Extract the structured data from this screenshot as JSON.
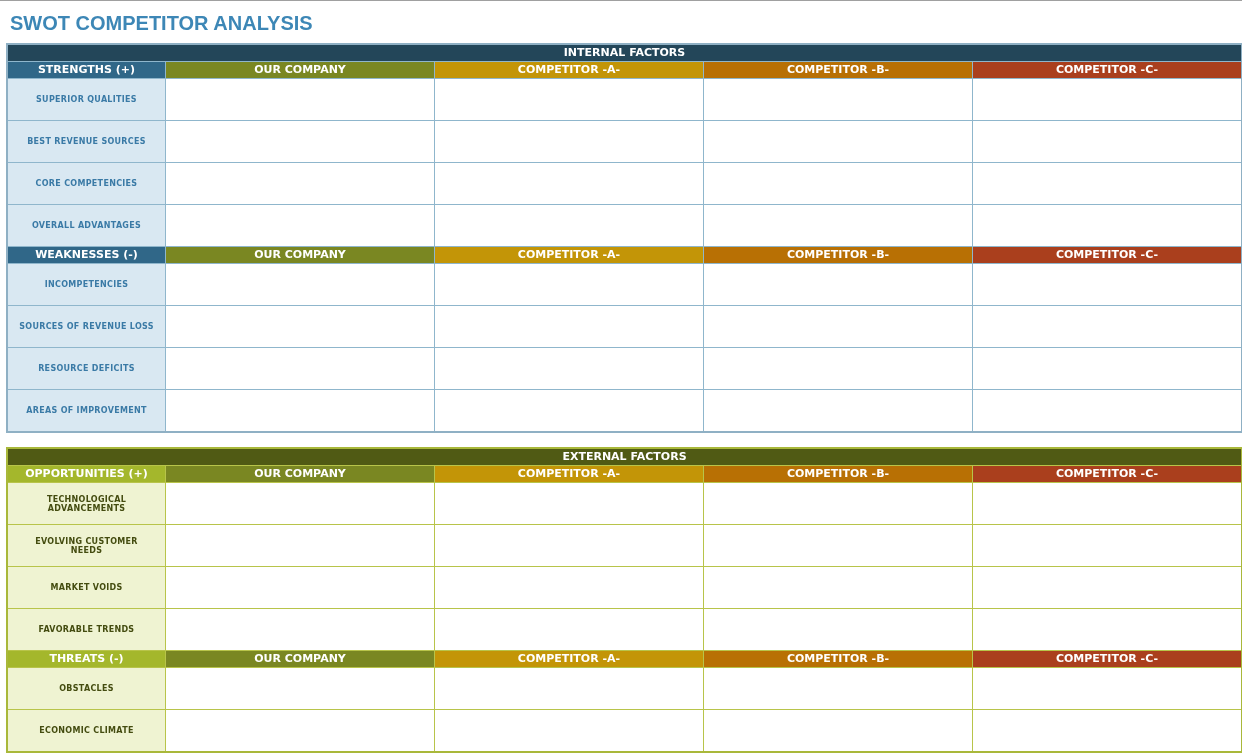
{
  "title": "SWOT COMPETITOR ANALYSIS",
  "sections": [
    {
      "kind": "internal",
      "heading": "INTERNAL FACTORS",
      "groups": [
        {
          "label": "STRENGTHS (+)",
          "columns": [
            {
              "label": "OUR COMPANY",
              "color": "#7a8722"
            },
            {
              "label": "COMPETITOR -A-",
              "color": "#c39507"
            },
            {
              "label": "COMPETITOR -B-",
              "color": "#b87004"
            },
            {
              "label": "COMPETITOR -C-",
              "color": "#aa3f1d"
            }
          ],
          "rows": [
            "SUPERIOR QUALITIES",
            "BEST REVENUE SOURCES",
            "CORE COMPETENCIES",
            "OVERALL ADVANTAGES"
          ]
        },
        {
          "label": "WEAKNESSES (-)",
          "columns": [
            {
              "label": "OUR COMPANY",
              "color": "#7a8722"
            },
            {
              "label": "COMPETITOR -A-",
              "color": "#c39507"
            },
            {
              "label": "COMPETITOR -B-",
              "color": "#b87004"
            },
            {
              "label": "COMPETITOR -C-",
              "color": "#aa3f1d"
            }
          ],
          "rows": [
            "INCOMPETENCIES",
            "SOURCES OF REVENUE LOSS",
            "RESOURCE DEFICITS",
            "AREAS OF IMPROVEMENT"
          ]
        }
      ]
    },
    {
      "kind": "external",
      "heading": "EXTERNAL FACTORS",
      "groups": [
        {
          "label": "OPPORTUNITIES (+)",
          "columns": [
            {
              "label": "OUR COMPANY",
              "color": "#7a8722"
            },
            {
              "label": "COMPETITOR -A-",
              "color": "#c39507"
            },
            {
              "label": "COMPETITOR -B-",
              "color": "#b87004"
            },
            {
              "label": "COMPETITOR -C-",
              "color": "#aa3f1d"
            }
          ],
          "rows": [
            "TECHNOLOGICAL ADVANCEMENTS",
            "EVOLVING CUSTOMER NEEDS",
            "MARKET VOIDS",
            "FAVORABLE TRENDS"
          ]
        },
        {
          "label": "THREATS (-)",
          "columns": [
            {
              "label": "OUR COMPANY",
              "color": "#7a8722"
            },
            {
              "label": "COMPETITOR -A-",
              "color": "#c39507"
            },
            {
              "label": "COMPETITOR -B-",
              "color": "#b87004"
            },
            {
              "label": "COMPETITOR -C-",
              "color": "#aa3f1d"
            }
          ],
          "rows": [
            "OBSTACLES",
            "ECONOMIC CLIMATE"
          ]
        }
      ]
    }
  ]
}
